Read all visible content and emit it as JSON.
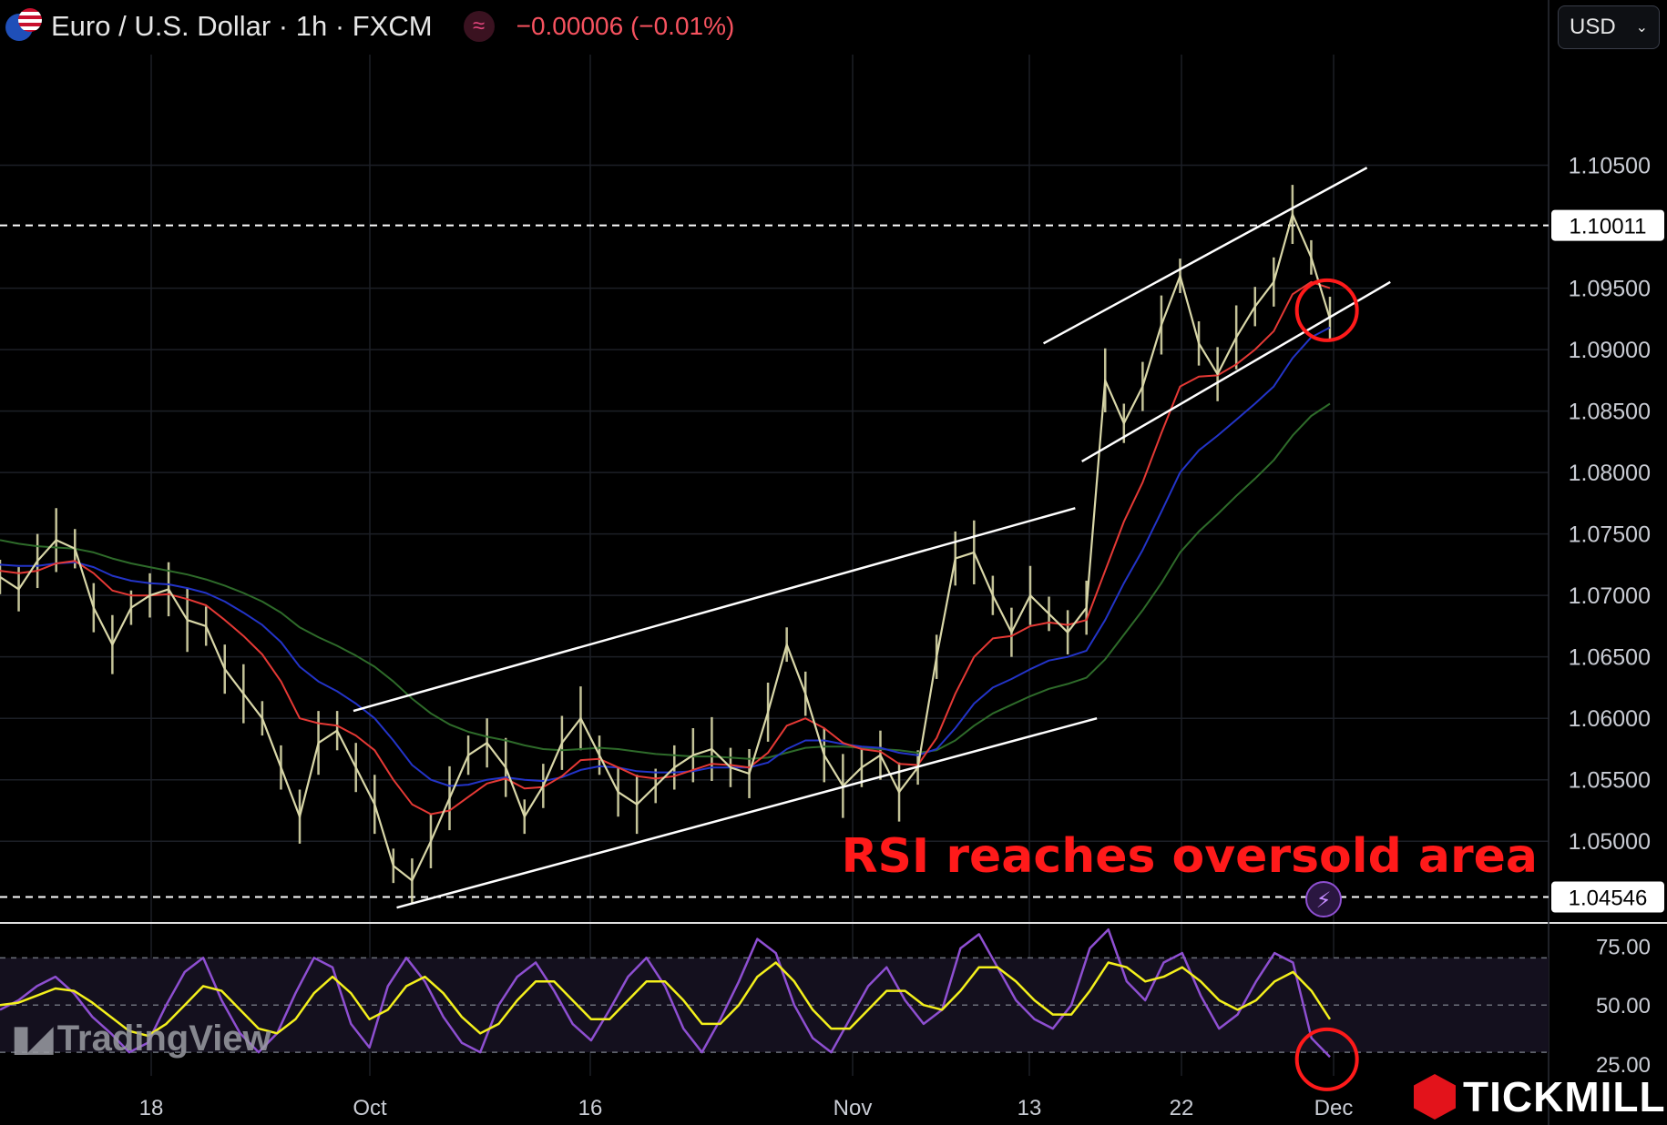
{
  "header": {
    "symbol": "Euro / U.S. Dollar · 1h · FXCM",
    "change": "−0.00006 (−0.01%)",
    "indicator_icon": "wave-icon",
    "flag_icon": "eur-usd-flag-icon"
  },
  "currency_selector": {
    "value": "USD"
  },
  "annotation": "RSI reaches oversold area",
  "watermark": "TradingView",
  "branding": "TICKMILL",
  "colors": {
    "background": "#000000",
    "candles": "#d9d7a8",
    "ema_red": "#e53935",
    "ema_blue": "#2334c8",
    "ema_green": "#2e6b2a",
    "rsi": "#8e4fd1",
    "rsi_ma": "#f4f01c",
    "annotation": "#ff1a1a"
  },
  "chart_data": [
    {
      "type": "line",
      "title": "Euro / U.S. Dollar · 1h · FXCM",
      "x_tick_labels": [
        "18",
        "Oct",
        "16",
        "Nov",
        "13",
        "22",
        "Dec"
      ],
      "y_ticks": [
        "1.10500",
        "1.09500",
        "1.09000",
        "1.08500",
        "1.08000",
        "1.07500",
        "1.07000",
        "1.06500",
        "1.06000",
        "1.05500",
        "1.05000"
      ],
      "ylim": [
        1.0435,
        1.114
      ],
      "price_lines": [
        {
          "value": 1.10011,
          "label": "1.10011"
        },
        {
          "value": 1.04546,
          "label": "1.04546"
        }
      ],
      "series": [
        {
          "values": [
            1.0715,
            1.0705,
            1.0728,
            1.0745,
            1.0738,
            1.069,
            1.066,
            1.069,
            1.07,
            1.0705,
            1.068,
            1.0675,
            1.064,
            1.062,
            1.06,
            1.056,
            1.052,
            1.058,
            1.059,
            1.056,
            1.053,
            1.048,
            1.0468,
            1.05,
            1.0535,
            1.057,
            1.058,
            1.056,
            1.052,
            1.0545,
            1.058,
            1.06,
            1.057,
            1.054,
            1.053,
            1.0545,
            1.056,
            1.057,
            1.0575,
            1.056,
            1.0555,
            1.0605,
            1.066,
            1.062,
            1.057,
            1.0545,
            1.056,
            1.057,
            1.054,
            1.056,
            1.065,
            1.073,
            1.0735,
            1.07,
            1.067,
            1.07,
            1.0685,
            1.067,
            1.069,
            1.0875,
            1.084,
            1.087,
            1.092,
            1.096,
            1.0905,
            1.088,
            1.091,
            1.0935,
            1.0955,
            1.101,
            1.0975,
            1.0925
          ]
        },
        {
          "values": [
            1.072,
            1.0718,
            1.072,
            1.0726,
            1.0728,
            1.0718,
            1.0704,
            1.07,
            1.07,
            1.0701,
            1.0697,
            1.0692,
            1.068,
            1.0667,
            1.0652,
            1.063,
            1.06,
            1.0596,
            1.0594,
            1.0586,
            1.0574,
            1.055,
            1.053,
            1.0522,
            1.0525,
            1.0536,
            1.0547,
            1.0551,
            1.0543,
            1.0544,
            1.0553,
            1.0566,
            1.0567,
            1.056,
            1.0553,
            1.0551,
            1.0553,
            1.0558,
            1.0563,
            1.0562,
            1.056,
            1.0572,
            1.0594,
            1.06,
            1.0592,
            1.058,
            1.0575,
            1.0573,
            1.0563,
            1.0562,
            1.0584,
            1.062,
            1.065,
            1.0665,
            1.0667,
            1.0675,
            1.0678,
            1.0676,
            1.068,
            1.072,
            1.076,
            1.0792,
            1.0832,
            1.087,
            1.0878,
            1.0879,
            1.0888,
            1.09,
            1.0915,
            1.0945,
            1.0955,
            1.095
          ]
        },
        {
          "values": [
            1.0725,
            1.0724,
            1.0724,
            1.0726,
            1.0727,
            1.0723,
            1.0716,
            1.0712,
            1.071,
            1.0709,
            1.0706,
            1.0702,
            1.0695,
            1.0686,
            1.0676,
            1.0662,
            1.0642,
            1.063,
            1.0622,
            1.0612,
            1.06,
            1.0582,
            1.0562,
            1.055,
            1.0545,
            1.0546,
            1.055,
            1.0552,
            1.055,
            1.0549,
            1.0552,
            1.0558,
            1.0561,
            1.056,
            1.0557,
            1.0556,
            1.0556,
            1.0557,
            1.056,
            1.056,
            1.056,
            1.0564,
            1.0575,
            1.0582,
            1.0582,
            1.0579,
            1.0577,
            1.0576,
            1.0572,
            1.057,
            1.0575,
            1.0592,
            1.0612,
            1.0625,
            1.0632,
            1.064,
            1.0647,
            1.065,
            1.0655,
            1.068,
            1.071,
            1.0737,
            1.0768,
            1.08,
            1.0818,
            1.083,
            1.0843,
            1.0856,
            1.087,
            1.0893,
            1.091,
            1.0918
          ]
        },
        {
          "values": [
            1.0745,
            1.0742,
            1.074,
            1.0739,
            1.0738,
            1.0735,
            1.073,
            1.0726,
            1.0723,
            1.072,
            1.0717,
            1.0713,
            1.0708,
            1.0702,
            1.0695,
            1.0686,
            1.0674,
            1.0666,
            1.0659,
            1.0651,
            1.0642,
            1.063,
            1.0616,
            1.0604,
            1.0595,
            1.0589,
            1.0585,
            1.0582,
            1.0578,
            1.0575,
            1.0574,
            1.0575,
            1.0576,
            1.0575,
            1.0573,
            1.0571,
            1.057,
            1.0569,
            1.0569,
            1.0568,
            1.0567,
            1.0568,
            1.0572,
            1.0576,
            1.0577,
            1.0577,
            1.0576,
            1.0575,
            1.0574,
            1.0572,
            1.0574,
            1.0582,
            1.0594,
            1.0604,
            1.0611,
            1.0618,
            1.0624,
            1.0628,
            1.0633,
            1.0648,
            1.0668,
            1.0688,
            1.071,
            1.0735,
            1.0752,
            1.0766,
            1.0781,
            1.0795,
            1.081,
            1.083,
            1.0846,
            1.0856
          ]
        }
      ],
      "trendlines": [
        {
          "points": [
            [
              0.212,
              1.0606
            ],
            [
              0.645,
              1.0771
            ]
          ]
        },
        {
          "points": [
            [
              0.238,
              1.0446
            ],
            [
              0.658,
              1.06
            ]
          ]
        },
        {
          "points": [
            [
              0.626,
              1.0905
            ],
            [
              0.82,
              1.1048
            ]
          ]
        },
        {
          "points": [
            [
              0.649,
              1.0809
            ],
            [
              0.834,
              1.0955
            ]
          ]
        }
      ],
      "highlight_circles": [
        {
          "x": 0.796,
          "y": 1.0932
        }
      ]
    },
    {
      "type": "line",
      "title": "RSI",
      "y_ticks": [
        "75.00",
        "50.00",
        "25.00"
      ],
      "ylim": [
        20,
        84
      ],
      "bands": [
        70,
        50,
        30
      ],
      "series": [
        {
          "values": [
            48,
            52,
            58,
            62,
            55,
            45,
            38,
            30,
            34,
            50,
            64,
            70,
            52,
            38,
            30,
            38,
            55,
            70,
            66,
            42,
            32,
            58,
            70,
            60,
            45,
            34,
            30,
            50,
            62,
            68,
            56,
            42,
            35,
            48,
            62,
            70,
            58,
            40,
            30,
            44,
            60,
            78,
            72,
            50,
            36,
            30,
            44,
            58,
            66,
            52,
            42,
            48,
            74,
            80,
            66,
            52,
            44,
            40,
            50,
            74,
            82,
            60,
            52,
            68,
            72,
            54,
            40,
            46,
            60,
            72,
            68,
            36,
            28
          ]
        },
        {
          "values": [
            50,
            51,
            54,
            57,
            56,
            51,
            45,
            39,
            37,
            42,
            50,
            58,
            56,
            48,
            40,
            38,
            44,
            55,
            62,
            55,
            44,
            48,
            58,
            62,
            55,
            45,
            38,
            42,
            52,
            60,
            60,
            52,
            44,
            44,
            52,
            60,
            60,
            52,
            42,
            42,
            50,
            62,
            68,
            60,
            48,
            40,
            40,
            48,
            56,
            56,
            50,
            48,
            56,
            66,
            66,
            60,
            52,
            46,
            46,
            56,
            68,
            66,
            60,
            62,
            66,
            60,
            52,
            48,
            52,
            60,
            64,
            56,
            44
          ]
        }
      ],
      "highlight_circles": [
        {
          "x": 0.796,
          "y": 27
        }
      ]
    }
  ]
}
